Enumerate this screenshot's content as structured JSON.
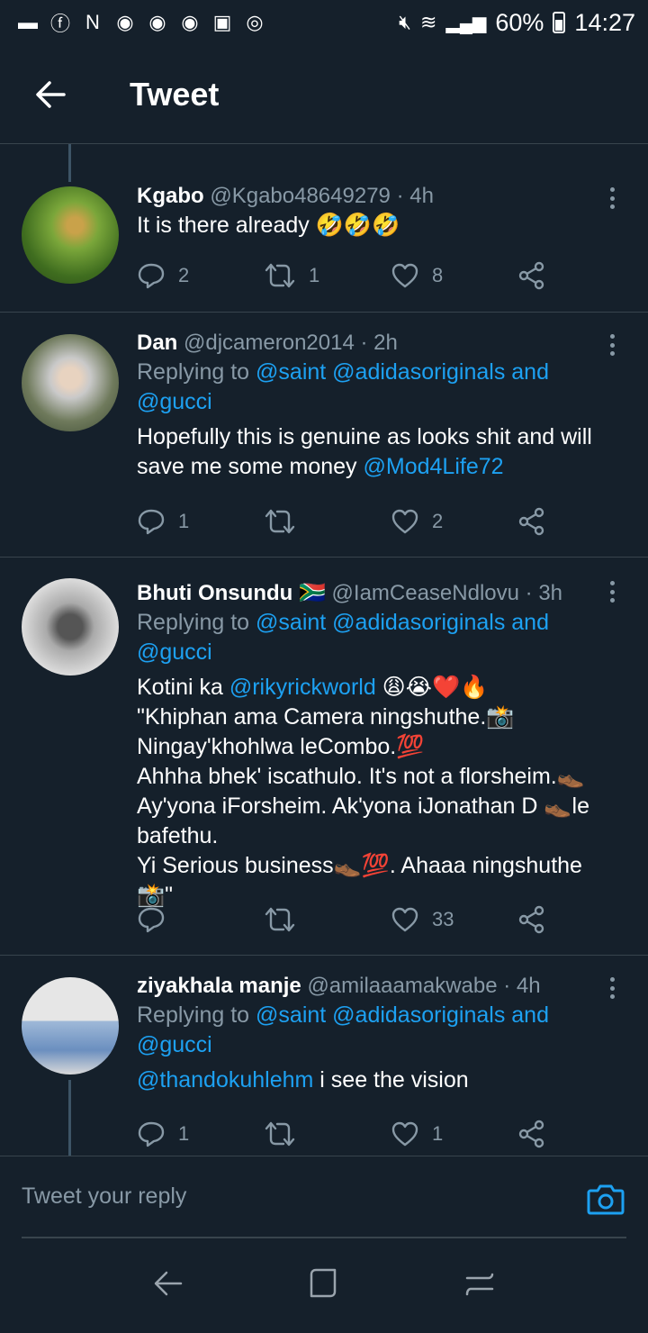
{
  "status_bar": {
    "notification_icons": [
      "message-icon",
      "facebook-icon",
      "news-icon",
      "chrome-icon",
      "chrome-icon",
      "chrome-icon",
      "gallery-icon",
      "vpn-icon"
    ],
    "battery": "60%",
    "time": "14:27"
  },
  "header": {
    "title": "Tweet"
  },
  "tweets": [
    {
      "name": "Kgabo",
      "handle": "@Kgabo48649279",
      "time": "· 4h",
      "text": "It is there already 🤣🤣🤣",
      "replies": "2",
      "retweets": "1",
      "likes": "8"
    },
    {
      "name": "Dan",
      "handle": "@djcameron2014",
      "time": "· 2h",
      "replying_prefix": "Replying to ",
      "replying_to": "@saint @adidasoriginals and @gucci",
      "text": "Hopefully this is genuine as looks shit and will save me some money ",
      "mention": "@Mod4Life72",
      "replies": "1",
      "retweets": "",
      "likes": "2"
    },
    {
      "name": "Bhuti Onsundu 🇿🇦",
      "handle": "@IamCeaseNdlovu",
      "time": "· 3h",
      "replying_prefix": "Replying to ",
      "replying_to": "@saint @adidasoriginals and @gucci",
      "text_prefix": "Kotini ka ",
      "mention": "@rikyrickworld",
      "text_suffix": " 😩😭❤️🔥",
      "lines": [
        "\"Khiphan ama Camera ningshuthe.📸",
        "Ningay'khohlwa leCombo.💯",
        "Ahhha bhek' iscathulo. It's not a florsheim.👞",
        "Ay'yona iForsheim. Ak'yona iJonathan D 👞le bafethu.",
        "Yi Serious business👞💯. Ahaaa ningshuthe📸\""
      ],
      "replies": "",
      "retweets": "",
      "likes": "33"
    },
    {
      "name": "ziyakhala manje",
      "handle": "@amilaaamakwabe",
      "time": "· 4h",
      "replying_prefix": "Replying to ",
      "replying_to": "@saint @adidasoriginals and @gucci",
      "mention": "@thandokuhlehm",
      "text": " i see the vision",
      "replies": "1",
      "retweets": "",
      "likes": "1"
    }
  ],
  "composer": {
    "placeholder": "Tweet your reply"
  },
  "colors": {
    "background": "#15202b",
    "accent": "#1da1f2",
    "muted": "#8899a6",
    "divider": "#38444d"
  }
}
